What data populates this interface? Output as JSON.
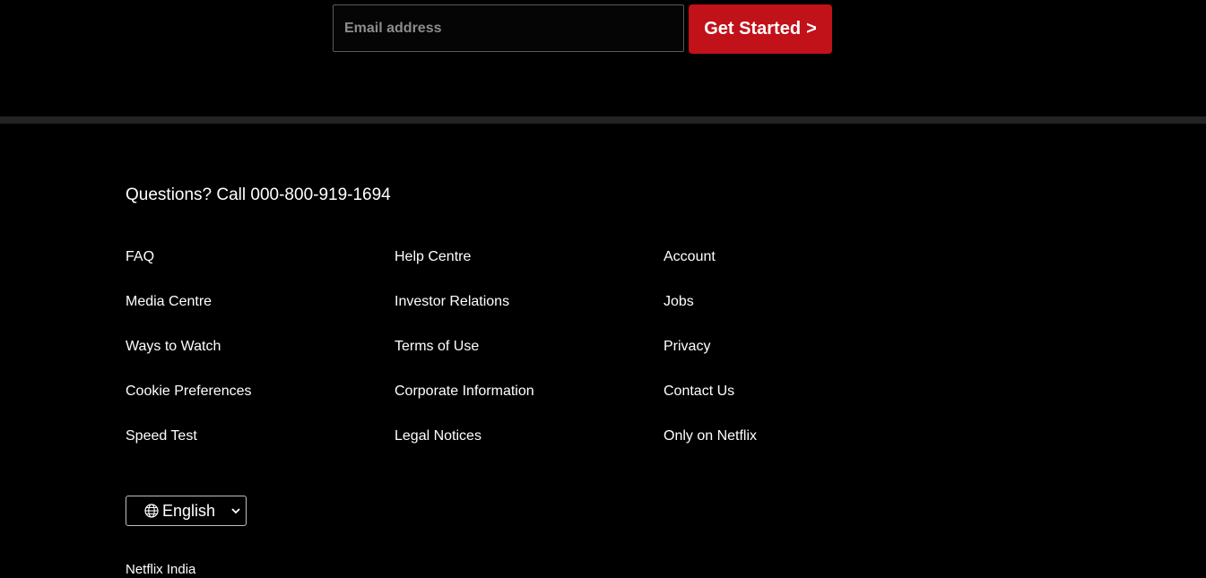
{
  "signup": {
    "email_placeholder": "Email address",
    "cta_label": "Get Started",
    "cta_chevron": ">",
    "cta_color": "#c11119"
  },
  "footer": {
    "questions": "Questions? Call 000-800-919-1694",
    "links": [
      "FAQ",
      "Help Centre",
      "Account",
      "Media Centre",
      "Investor Relations",
      "Jobs",
      "Ways to Watch",
      "Terms of Use",
      "Privacy",
      "Cookie Preferences",
      "Corporate Information",
      "Contact Us",
      "Speed Test",
      "Legal Notices",
      "Only on Netflix"
    ],
    "language": {
      "icon": "globe-icon",
      "selected": "English",
      "chevron_icon": "chevron-down-icon"
    },
    "country": "Netflix India"
  }
}
